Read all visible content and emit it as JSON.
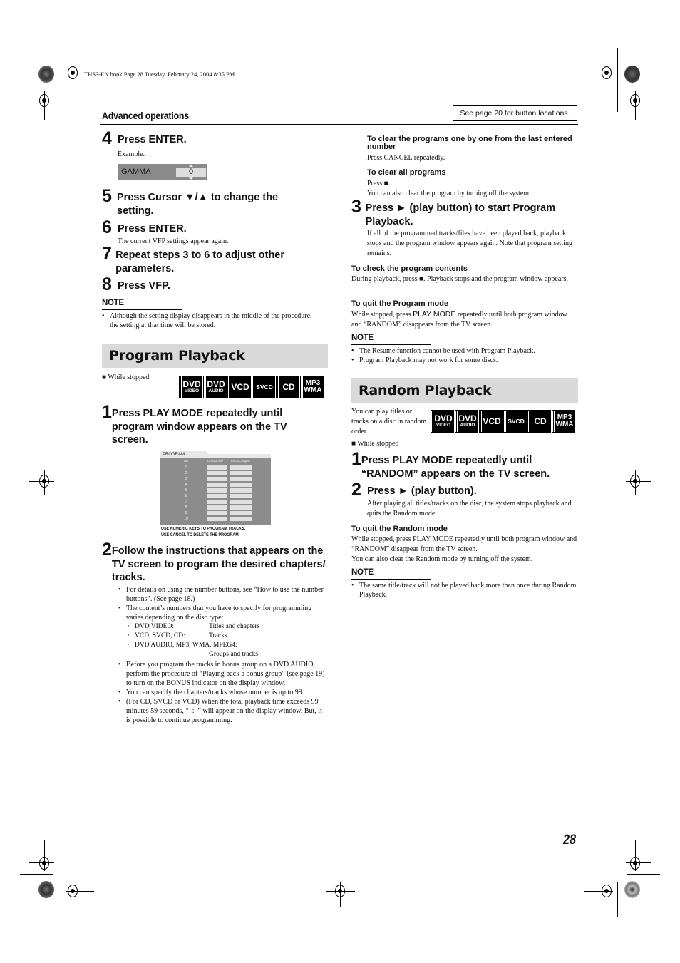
{
  "print_info": "THS3-EN.book  Page 28  Tuesday, February 24, 2004  8:35 PM",
  "header": {
    "section": "Advanced operations",
    "see_page_note": "See page 20 for button locations."
  },
  "left_column": {
    "step4": {
      "num": "4",
      "title": "Press ENTER.",
      "example_label": "Example:",
      "gamma_display": {
        "label": "GAMMA",
        "value": "0"
      }
    },
    "step5": {
      "num": "5",
      "title": "Press Cursor ▼/▲ to change the setting."
    },
    "step6": {
      "num": "6",
      "title": "Press ENTER.",
      "body": "The current VFP settings appear again."
    },
    "step7": {
      "num": "7",
      "title": "Repeat steps 3 to 6 to adjust other parameters."
    },
    "step8": {
      "num": "8",
      "title": "Press VFP."
    },
    "note1": {
      "title": "NOTE",
      "items": [
        "Although the setting display disappears in the middle of the procedure, the setting at that time will be stored."
      ]
    },
    "program_playback": {
      "banner": "Program Playback",
      "while_stopped": "■  While stopped",
      "disc_badges": [
        {
          "main": "DVD",
          "sub": "VIDEO"
        },
        {
          "main": "DVD",
          "sub": "AUDIO"
        },
        {
          "main": "VCD"
        },
        {
          "main": "SVCD"
        },
        {
          "main": "CD"
        },
        {
          "main": "MP3",
          "sub": "WMA"
        }
      ],
      "step1": {
        "num": "1",
        "title": "Press PLAY MODE repeatedly until program window appears on the TV screen."
      },
      "program_window": {
        "tab": "PROGRAM",
        "columns": [
          "No.",
          "Group/Title",
          "Track/Chapter"
        ],
        "rows": [
          "1",
          "2",
          "3",
          "4",
          "5",
          "6",
          "7",
          "8",
          "9",
          "10"
        ],
        "footer_line1": "USE NUMERIC KEYS TO PROGRAM TRACKS.",
        "footer_line2": "USE CANCEL TO DELETE THE PROGRAM."
      },
      "step2": {
        "num": "2",
        "title": "Follow the instructions that appears on the TV screen to program the desired chapters/ tracks.",
        "bullets": [
          "For details on using the number buttons, see “How to use the number buttons”. (See page 18.)",
          "The content’s numbers that you have to specify for programming varies depending on the disc type:",
          "Before you program the tracks in bonus group on a DVD AUDIO, perform the procedure of “Playing back a bonus group” (see page 19) to turn on the BONUS indicator on the display window.",
          "You can specify the chapters/tracks whose number is up to 99.",
          "(For CD, SVCD or VCD) When the total playback time exceeds 99 minutes 59 seconds, “–:–” will appear on the display window. But, it is possible to continue programming."
        ],
        "disc_types": [
          {
            "type": "DVD VIDEO:",
            "content": "Titles and chapters"
          },
          {
            "type": "VCD, SVCD, CD:",
            "content": "Tracks"
          },
          {
            "type": "DVD AUDIO, MP3, WMA, MPEG4:",
            "content": "Groups and tracks"
          }
        ]
      }
    }
  },
  "right_column": {
    "clear_one": {
      "title": "To clear the programs one by one from the last entered number",
      "body": "Press CANCEL repeatedly."
    },
    "clear_all": {
      "title": "To clear all programs",
      "body1": "Press ■.",
      "body2": "You can also clear the program by turning off the system."
    },
    "step3": {
      "num": "3",
      "title": "Press ► (play button) to start Program Playback.",
      "body": "If all of the programmed tracks/files have been played back, playback stops and the program window appears again. Note that program setting remains."
    },
    "check_contents": {
      "title": "To check the program contents",
      "body": "During playback, press ■. Playback stops and the program window appears."
    },
    "quit_program": {
      "title": "To quit the Program mode",
      "body_pre": "While stopped, press ",
      "body_key": "PLAY MODE",
      "body_post": " repeatedly until both program window and “RANDOM” disappears from the TV screen."
    },
    "note2": {
      "title": "NOTE",
      "items": [
        "The Resume function cannot be used with Program Playback.",
        "Program Playback may not work for some discs."
      ]
    },
    "random_playback": {
      "banner": "Random Playback",
      "intro": "You can play titles or tracks on a disc in random order.",
      "while_stopped": "■  While stopped",
      "step1": {
        "num": "1",
        "title": "Press PLAY MODE repeatedly until “RANDOM” appears on the TV screen."
      },
      "step2": {
        "num": "2",
        "title": "Press ► (play button).",
        "body": "After playing all titles/tracks on the disc, the system stops playback and quits the Random mode."
      },
      "quit_random": {
        "title": "To quit the Random mode",
        "body1": "While stopped, press PLAY MODE repeatedly until both program window and “RANDOM” disappear from the TV screen.",
        "body2": "You can also clear the Random mode by turning off the system."
      },
      "note3": {
        "title": "NOTE",
        "items": [
          "The same title/track will not be played back more than once during Random Playback."
        ]
      }
    }
  },
  "page_number": "28"
}
